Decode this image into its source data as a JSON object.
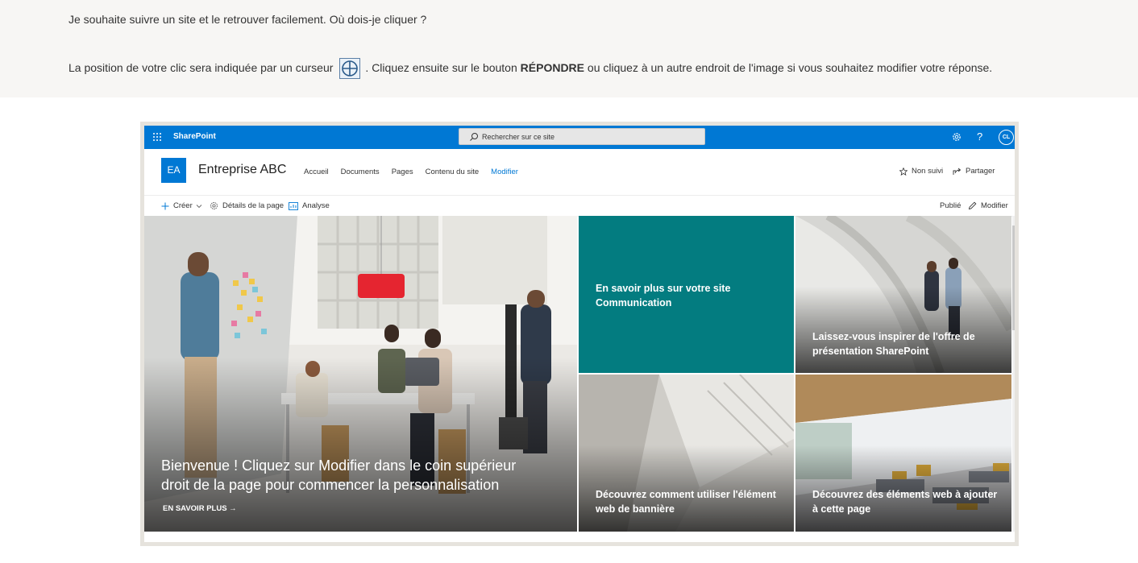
{
  "question": {
    "line1": "Je souhaite suivre un site et le retrouver facilement. Où dois-je cliquer ?",
    "line2_part1": "La position de votre clic sera indiquée par un curseur",
    "line2_part2": ". Cliquez ensuite sur le bouton",
    "line2_bold": "RÉPONDRE",
    "line2_part3": "ou cliquez à un autre endroit de l'image si vous souhaitez modifier votre réponse."
  },
  "suite_bar": {
    "app_name": "SharePoint",
    "search_placeholder": "Rechercher sur ce site",
    "help_label": "?",
    "avatar_initials": "CL"
  },
  "site": {
    "logo_initials": "EA",
    "title": "Entreprise ABC",
    "nav": [
      "Accueil",
      "Documents",
      "Pages",
      "Contenu du site",
      "Modifier"
    ],
    "follow_label": "Non suivi",
    "share_label": "Partager"
  },
  "command_bar": {
    "create_label": "Créer",
    "details_label": "Détails de la page",
    "analytics_label": "Analyse",
    "status_label": "Publié",
    "edit_label": "Modifier"
  },
  "hero": {
    "main_title": "Bienvenue ! Cliquez sur Modifier dans le coin supérieur droit de la page pour commencer la personnalisation",
    "learn_more": "EN SAVOIR PLUS →",
    "tile_teal": "En savoir plus sur votre site Communication",
    "tile_top_right": "Laissez-vous inspirer de l'offre de présentation SharePoint",
    "tile_bottom_mid": "Découvrez comment utiliser l'élément web de bannière",
    "tile_bottom_right": "Découvrez des éléments web à ajouter à cette page"
  },
  "colors": {
    "suite_blue": "#0078d4",
    "teal_tile": "#037c80",
    "question_bg": "#f7f6f4"
  },
  "icons": [
    "waffle-icon",
    "search-icon",
    "gear-icon",
    "star-icon",
    "share-icon",
    "plus-icon",
    "chevron-down-icon",
    "page-details-icon",
    "analytics-icon",
    "pencil-icon",
    "cursor-icon",
    "arrow-right-icon"
  ]
}
